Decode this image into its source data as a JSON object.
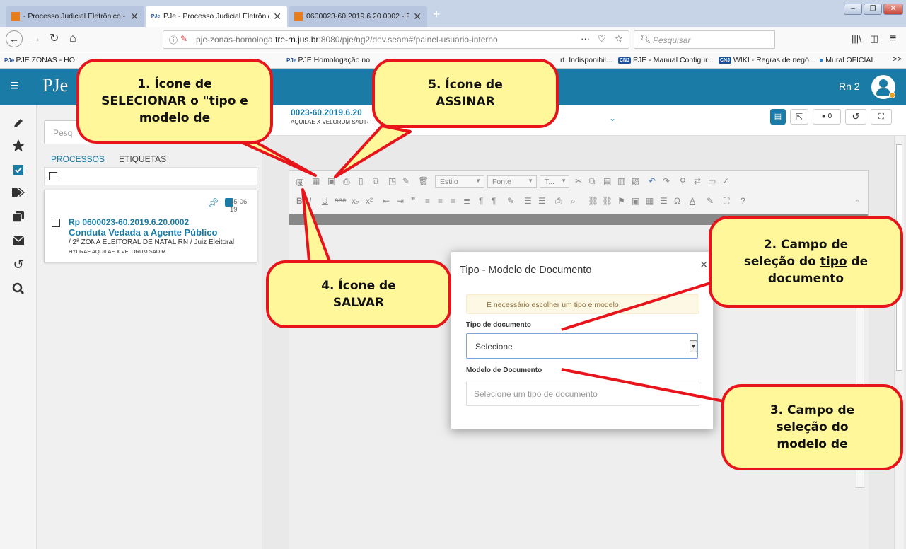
{
  "browser": {
    "tabs": [
      {
        "label": "- Processo Judicial Eletrônico -",
        "icon": "pje-icon"
      },
      {
        "label": "PJe - Processo Judicial Eletrônico -",
        "icon": "pje-icon"
      },
      {
        "label": "0600023-60.2019.6.20.0002 - Pro",
        "icon": "pje-icon"
      }
    ],
    "url_prefix": "pje-zonas-homologa.",
    "url_domain": "tre-rn.jus.br",
    "url_suffix": ":8080/pje/ng2/dev.seam#/painel-usuario-interno",
    "search_placeholder": "Pesquisar",
    "bookmarks": [
      "PJE ZONAS - HO",
      "PJE Homologação no",
      "rt. Indisponibil...",
      "PJE - Manual Configur...",
      "WIKI - Regras de negó...",
      "Mural OFICIAL"
    ],
    "overflow": ">>"
  },
  "app": {
    "logo": "PJe",
    "user": "Rn 2",
    "search_placeholder": "Pesq",
    "tabs": [
      "PROCESSOS",
      "ETIQUETAS"
    ],
    "process": {
      "date": "25-06-19",
      "number": "Rp 0600023-60.2019.6.20.0002",
      "subject": "Conduta Vedada a Agente Público",
      "court": "/ 2ª ZONA ELEITORAL DE NATAL RN / Juiz Eleitoral",
      "parties": "HYDRAE AQUILAE X VELORUM SADIR"
    },
    "header_number": "0023-60.2019.6.20",
    "header_parties": "AQUILAE X VELORUM SADIR",
    "tag_count": "0",
    "editor": {
      "estilo": "Estilo",
      "fonte": "Fonte",
      "tamanho": "T..."
    }
  },
  "modal": {
    "title": "Tipo - Modelo de Documento",
    "warning": "É necessário escolher um tipo e modelo",
    "tipo_label": "Tipo de documento",
    "tipo_value": "Selecione",
    "modelo_label": "Modelo de Documento",
    "modelo_placeholder": "Selecione um tipo de documento",
    "close": "×"
  },
  "callouts": {
    "c1": {
      "line1": "1. Ícone de",
      "line2": "SELECIONAR o \"tipo e",
      "line3": "modelo de"
    },
    "c2": {
      "line1": "2. Campo de",
      "line2a": "seleção do ",
      "line2b": "tipo",
      "line2c": " de",
      "line3": "documento"
    },
    "c3": {
      "line1": "3. Campo de",
      "line2": "seleção do",
      "line3a": "modelo",
      "line3b": " de"
    },
    "c4": {
      "line1": "4. Ícone de",
      "line2": "SALVAR"
    },
    "c5": {
      "line1": "5. Ícone de",
      "line2": "ASSINAR"
    }
  },
  "colors": {
    "header": "#1a7ba6",
    "callout_fill": "#fff79a",
    "callout_border": "#e8141b",
    "link": "#1a7ba6"
  }
}
